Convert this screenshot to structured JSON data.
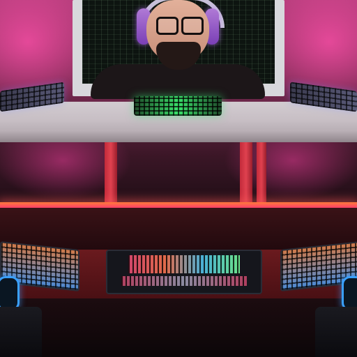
{
  "scene": {
    "accent_colors": {
      "wall_pink": "#b03c78",
      "desk_leg_red": "#e0414f",
      "led_strip": "#ff5a5a",
      "keyboard_green": "#3ae06a",
      "headset_purple": "#b07ad6",
      "speaker_blue": "#3aa0ff"
    },
    "objects": [
      {
        "name": "monitor-icon"
      },
      {
        "name": "person-with-headset-icon"
      },
      {
        "name": "keyboard-icon"
      },
      {
        "name": "mixer-icon"
      },
      {
        "name": "speaker-icon"
      },
      {
        "name": "chair-icon"
      }
    ]
  }
}
